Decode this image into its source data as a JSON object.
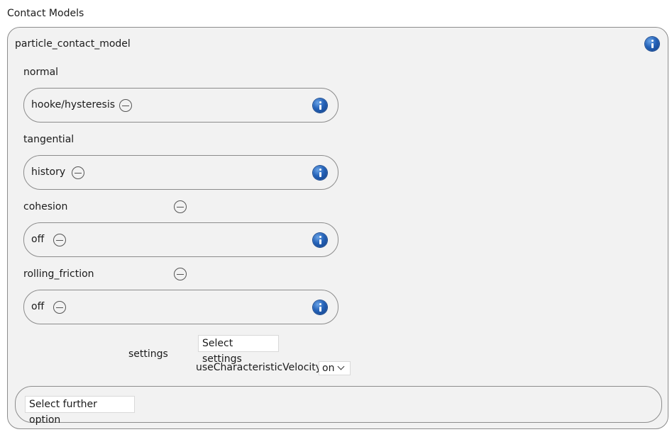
{
  "section_title": "Contact Models",
  "model_name": "particle_contact_model",
  "normal": {
    "label": "normal",
    "value": "hooke/hysteresis"
  },
  "tangential": {
    "label": "tangential",
    "value": "history"
  },
  "cohesion": {
    "label": "cohesion",
    "value": "off"
  },
  "rolling_friction": {
    "label": "rolling_friction",
    "value": "off"
  },
  "settings": {
    "label": "settings",
    "select_button": "Select settings",
    "use_char_velocity_label": "useCharacteristicVelocity",
    "use_char_velocity_value": "on"
  },
  "further_option_button": "Select further option",
  "icons": {
    "info": "info-icon",
    "remove": "minus-circle-icon",
    "dropdown": "chevron-down-icon"
  }
}
